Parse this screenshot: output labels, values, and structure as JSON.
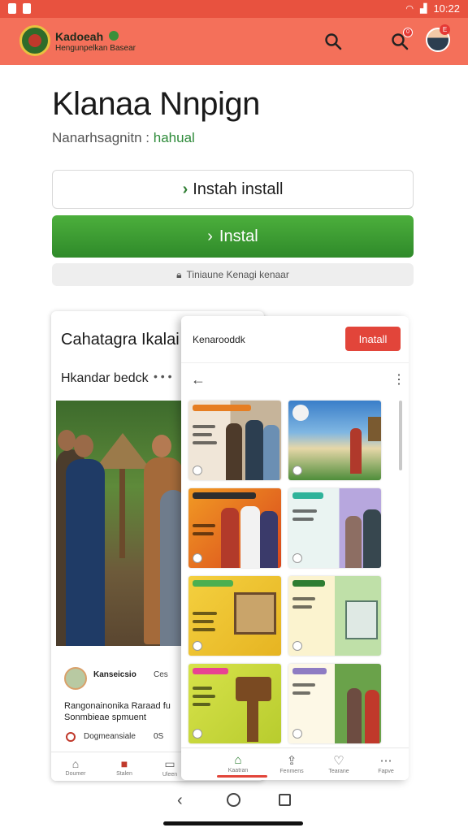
{
  "status_bar": {
    "time": "10:22"
  },
  "header": {
    "brand_name": "Kadoeah",
    "brand_sub": "Hengunpelkan Basear",
    "notification_count": "0",
    "avatar_badge": "E"
  },
  "hero": {
    "title": "Klanaa Nnpign",
    "subtitle_prefix": "Nanarhsagnitn : ",
    "subtitle_accent": "hahual"
  },
  "buttons": {
    "secondary_label": "Instah install",
    "primary_label": "Instal",
    "hint": "Tiniaune Kenagi kenaar"
  },
  "back_card": {
    "title": "Cahatagra Ikalai",
    "subtitle": "Hkandar bedck",
    "author": "Kanseicsio",
    "author_meta": "Ces",
    "description_line1": "Rangonainonika Raraad fu",
    "description_line2": "Sonmbieae spmuent",
    "footer_label": "Dogmeansiale",
    "footer_number": "0S",
    "nav": [
      "Doumer",
      "Stalen",
      "Uleen"
    ]
  },
  "front_card": {
    "header_title": "Kenarooddk",
    "install_label": "Inatall",
    "nav": [
      "Kaatran",
      "Fenmens",
      "Tearane",
      "Fapve"
    ]
  },
  "colors": {
    "status_bar": "#e8523f",
    "app_bar": "#f4705a",
    "primary_green": "#2f8a2a",
    "install_red": "#e2453a"
  },
  "icons": [
    "search-icon",
    "bell-icon",
    "lock-icon",
    "back-arrow-icon",
    "more-vert-icon",
    "home-icon"
  ]
}
